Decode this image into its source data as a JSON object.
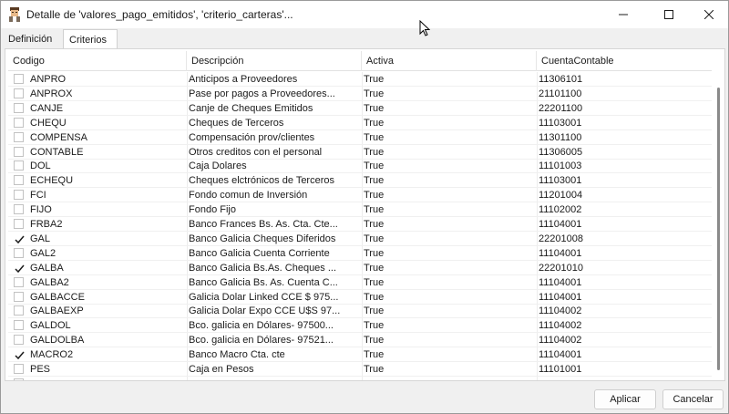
{
  "window": {
    "title": "Detalle de 'valores_pago_emitidos', 'criterio_carteras'..."
  },
  "tabs": [
    {
      "label": "Definición"
    },
    {
      "label": "Criterios"
    }
  ],
  "table": {
    "columns": [
      "Codigo",
      "Descripción",
      "Activa",
      "CuentaContable"
    ],
    "rows": [
      {
        "checked": false,
        "code": "ANPRO",
        "desc": "Anticipos a Proveedores",
        "active": "True",
        "account": "11306101"
      },
      {
        "checked": false,
        "code": "ANPROX",
        "desc": "Pase por pagos a  Proveedores...",
        "active": "True",
        "account": "21101100"
      },
      {
        "checked": false,
        "code": "CANJE",
        "desc": "Canje de Cheques Emitidos",
        "active": "True",
        "account": "22201100"
      },
      {
        "checked": false,
        "code": "CHEQU",
        "desc": "Cheques de Terceros",
        "active": "True",
        "account": "11103001"
      },
      {
        "checked": false,
        "code": "COMPENSA",
        "desc": "Compensación prov/clientes",
        "active": "True",
        "account": "11301100"
      },
      {
        "checked": false,
        "code": "CONTABLE",
        "desc": "Otros creditos con el personal",
        "active": "True",
        "account": "11306005"
      },
      {
        "checked": false,
        "code": "DOL",
        "desc": "Caja Dolares",
        "active": "True",
        "account": "11101003"
      },
      {
        "checked": false,
        "code": "ECHEQU",
        "desc": "Cheques elctrónicos de Terceros",
        "active": "True",
        "account": "11103001"
      },
      {
        "checked": false,
        "code": "FCI",
        "desc": "Fondo comun de Inversión",
        "active": "True",
        "account": "11201004"
      },
      {
        "checked": false,
        "code": "FIJO",
        "desc": "Fondo Fijo",
        "active": "True",
        "account": "11102002"
      },
      {
        "checked": false,
        "code": "FRBA2",
        "desc": "Banco Frances Bs. As. Cta. Cte...",
        "active": "True",
        "account": "11104001"
      },
      {
        "checked": true,
        "code": "GAL",
        "desc": "Banco Galicia Cheques Diferidos",
        "active": "True",
        "account": "22201008"
      },
      {
        "checked": false,
        "code": "GAL2",
        "desc": "Banco Galicia Cuenta Corriente",
        "active": "True",
        "account": "11104001"
      },
      {
        "checked": true,
        "code": "GALBA",
        "desc": "Banco Galicia Bs.As. Cheques ...",
        "active": "True",
        "account": "22201010"
      },
      {
        "checked": false,
        "code": "GALBA2",
        "desc": "Banco Galicia Bs. As. Cuenta C...",
        "active": "True",
        "account": "11104001"
      },
      {
        "checked": false,
        "code": "GALBACCE",
        "desc": "Galicia Dolar Linked CCE $ 975...",
        "active": "True",
        "account": "11104001"
      },
      {
        "checked": false,
        "code": "GALBAEXP",
        "desc": "Galicia Dolar Expo CCE U$S 97...",
        "active": "True",
        "account": "11104002"
      },
      {
        "checked": false,
        "code": "GALDOL",
        "desc": "Bco. galicia en Dólares- 97500...",
        "active": "True",
        "account": "11104002"
      },
      {
        "checked": false,
        "code": "GALDOLBA",
        "desc": "Bco. galicia en Dólares- 97521...",
        "active": "True",
        "account": "11104002"
      },
      {
        "checked": true,
        "code": "MACRO2",
        "desc": "Banco Macro Cta. cte",
        "active": "True",
        "account": "11104001"
      },
      {
        "checked": false,
        "code": "PES",
        "desc": "Caja en Pesos",
        "active": "True",
        "account": "11101001"
      },
      {
        "checked": false,
        "code": "",
        "desc": "",
        "active": "",
        "account": ""
      }
    ]
  },
  "buttons": {
    "apply": "Aplicar",
    "cancel": "Cancelar"
  },
  "icons": {
    "app": "app-icon",
    "minimize": "minimize-icon",
    "maximize": "maximize-icon",
    "close": "close-icon",
    "check": "checkmark-icon",
    "cursor": "mouse-cursor-icon"
  }
}
